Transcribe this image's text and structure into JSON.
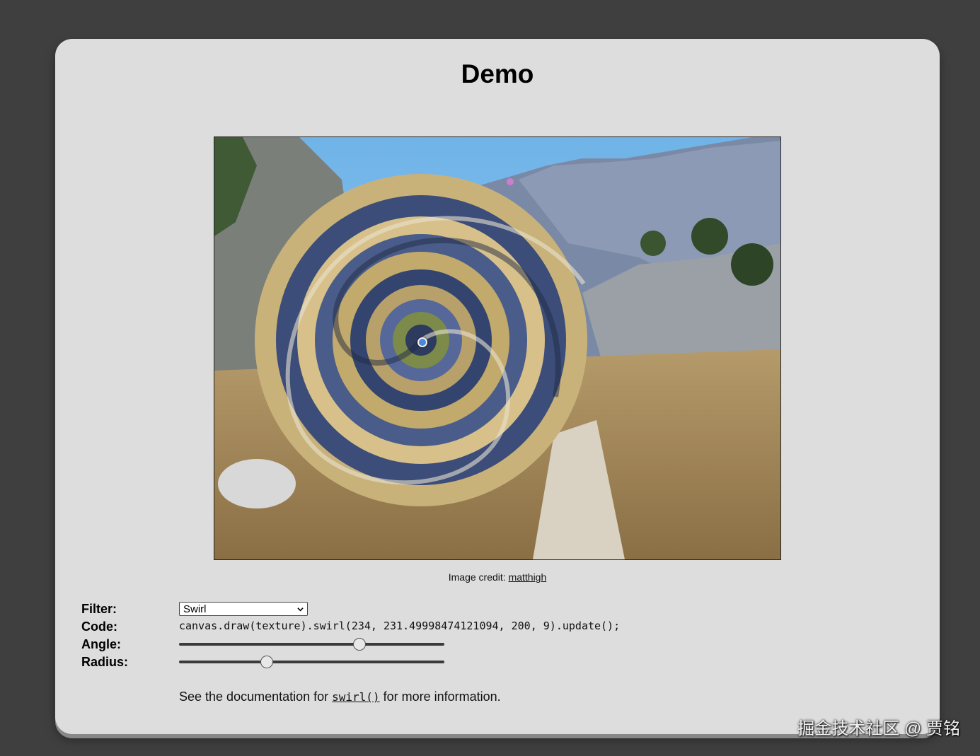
{
  "page": {
    "title": "Demo"
  },
  "image": {
    "credit_prefix": "Image credit: ",
    "credit_link": "matthigh"
  },
  "controls": {
    "filter_label": "Filter:",
    "filter_value": "Swirl",
    "code_label": "Code:",
    "code_value": "canvas.draw(texture).swirl(234, 231.49998474121094, 200, 9).update();",
    "angle_label": "Angle:",
    "angle_level": 0.68,
    "radius_label": "Radius:",
    "radius_level": 0.33
  },
  "docs": {
    "prefix": "See the documentation for ",
    "link": "swirl()",
    "suffix": " for more information."
  },
  "watermark": "掘金技术社区 @ 贾铭"
}
